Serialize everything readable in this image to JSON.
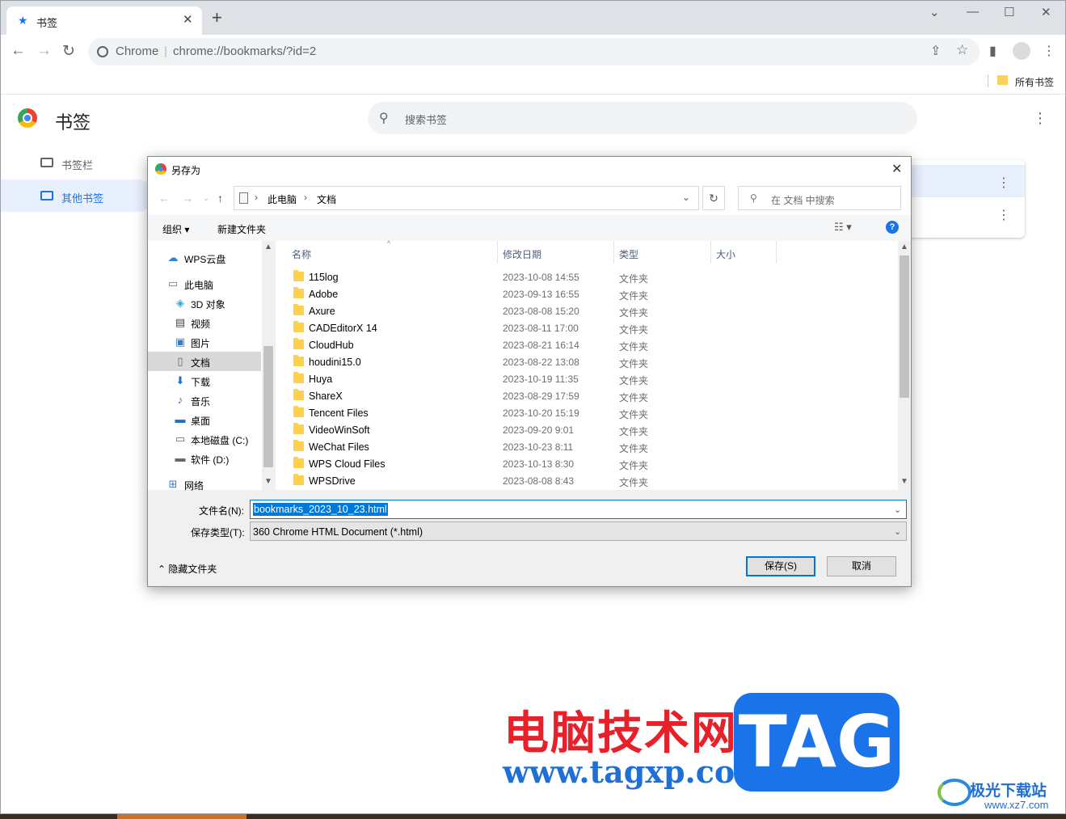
{
  "browser": {
    "tab_title": "书签",
    "omnibox_site": "Chrome",
    "omnibox_url": "chrome://bookmarks/?id=2",
    "bookmarks_bar_all": "所有书签"
  },
  "bookmarks_page": {
    "title": "书签",
    "search_placeholder": "搜索书签",
    "sidebar": [
      {
        "label": "书签栏",
        "active": false
      },
      {
        "label": "其他书签",
        "active": true
      }
    ]
  },
  "dialog": {
    "title": "另存为",
    "breadcrumb": [
      "此电脑",
      "文档"
    ],
    "search_placeholder": "在 文档 中搜索",
    "organize_label": "组织 ▾",
    "new_folder_label": "新建文件夹",
    "help_label": "?",
    "nav_items": [
      {
        "label": "WPS云盘",
        "icon": "cloud-icon"
      },
      {
        "label": "此电脑",
        "icon": "computer-icon"
      },
      {
        "label": "3D 对象",
        "icon": "cube-icon"
      },
      {
        "label": "视频",
        "icon": "video-icon"
      },
      {
        "label": "图片",
        "icon": "picture-icon"
      },
      {
        "label": "文档",
        "icon": "document-icon",
        "selected": true
      },
      {
        "label": "下载",
        "icon": "download-icon"
      },
      {
        "label": "音乐",
        "icon": "music-icon"
      },
      {
        "label": "桌面",
        "icon": "desktop-icon"
      },
      {
        "label": "本地磁盘 (C:)",
        "icon": "drive-icon"
      },
      {
        "label": "软件 (D:)",
        "icon": "drive-icon"
      },
      {
        "label": "网络",
        "icon": "network-icon"
      }
    ],
    "columns": [
      "名称",
      "修改日期",
      "类型",
      "大小"
    ],
    "files": [
      {
        "name": "115log",
        "date": "2023-10-08 14:55",
        "type": "文件夹"
      },
      {
        "name": "Adobe",
        "date": "2023-09-13 16:55",
        "type": "文件夹"
      },
      {
        "name": "Axure",
        "date": "2023-08-08 15:20",
        "type": "文件夹"
      },
      {
        "name": "CADEditorX 14",
        "date": "2023-08-11 17:00",
        "type": "文件夹"
      },
      {
        "name": "CloudHub",
        "date": "2023-08-21 16:14",
        "type": "文件夹"
      },
      {
        "name": "houdini15.0",
        "date": "2023-08-22 13:08",
        "type": "文件夹"
      },
      {
        "name": "Huya",
        "date": "2023-10-19 11:35",
        "type": "文件夹"
      },
      {
        "name": "ShareX",
        "date": "2023-08-29 17:59",
        "type": "文件夹"
      },
      {
        "name": "Tencent Files",
        "date": "2023-10-20 15:19",
        "type": "文件夹"
      },
      {
        "name": "VideoWinSoft",
        "date": "2023-09-20 9:01",
        "type": "文件夹"
      },
      {
        "name": "WeChat Files",
        "date": "2023-10-23 8:11",
        "type": "文件夹"
      },
      {
        "name": "WPS Cloud Files",
        "date": "2023-10-13 8:30",
        "type": "文件夹"
      },
      {
        "name": "WPSDrive",
        "date": "2023-08-08 8:43",
        "type": "文件夹"
      }
    ],
    "filename_label": "文件名(N):",
    "filename_value": "bookmarks_2023_10_23.html",
    "filetype_label": "保存类型(T):",
    "filetype_value": "360 Chrome HTML Document (*.html)",
    "hide_folders_label": "隐藏文件夹",
    "save_label": "保存(S)",
    "cancel_label": "取消"
  },
  "watermark": {
    "cn_text": "电脑技术网",
    "url": "www.tagxp.com",
    "tag": "TAG",
    "brand": "极光下载站",
    "brand_site": "www.xz7.com"
  },
  "colors": {
    "accent": "#1a73e8",
    "selection": "#0078d7",
    "folder": "#ffd04e",
    "watermark_red": "#e8202a"
  }
}
